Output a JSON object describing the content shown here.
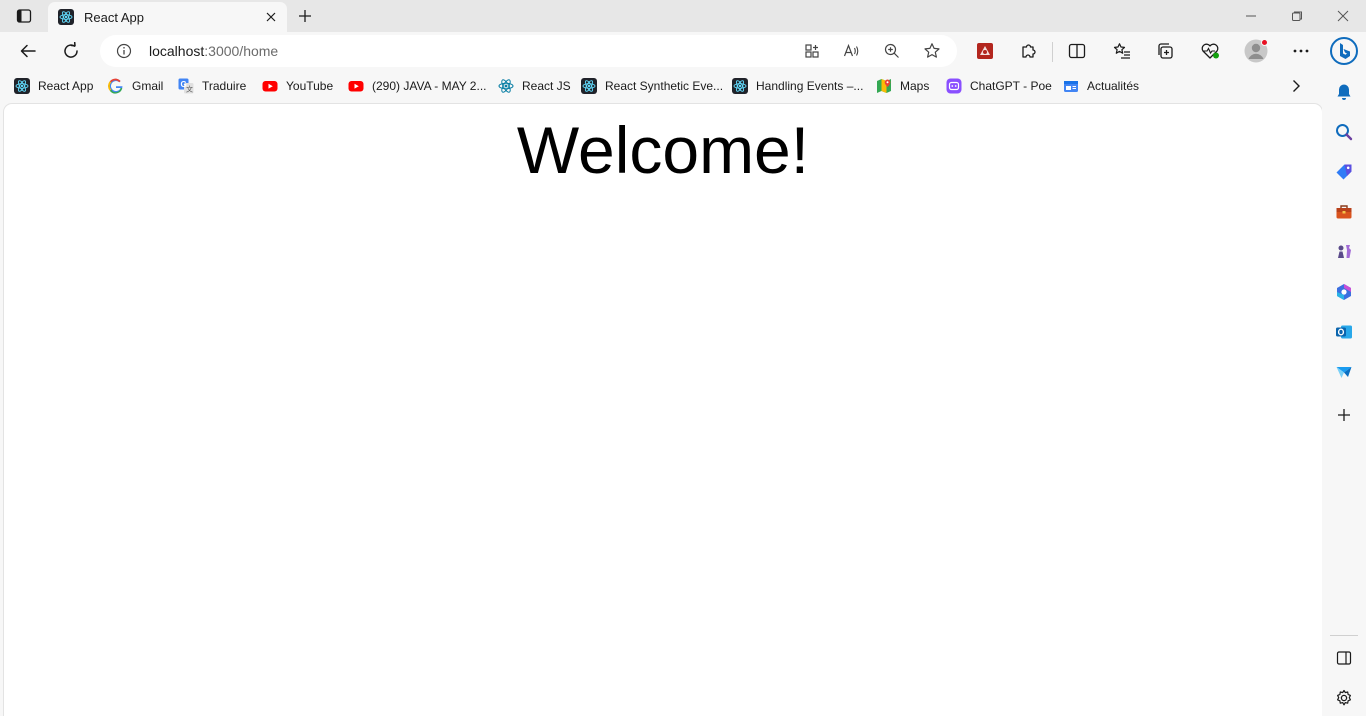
{
  "tab": {
    "title": "React App",
    "favicon": "react-icon"
  },
  "toolbar": {
    "url_host": "localhost",
    "url_path": ":3000/home"
  },
  "favorites": [
    {
      "label": "React App",
      "icon": "react-icon"
    },
    {
      "label": "Gmail",
      "icon": "google-icon"
    },
    {
      "label": "Traduire",
      "icon": "translate-icon"
    },
    {
      "label": "YouTube",
      "icon": "youtube-icon"
    },
    {
      "label": "(290) JAVA - MAY 2...",
      "icon": "youtube-icon"
    },
    {
      "label": "React JS",
      "icon": "react-icon"
    },
    {
      "label": "React Synthetic Eve...",
      "icon": "react-icon"
    },
    {
      "label": "Handling Events –...",
      "icon": "react-icon"
    },
    {
      "label": "Maps",
      "icon": "maps-icon"
    },
    {
      "label": "ChatGPT - Poe",
      "icon": "poe-icon"
    },
    {
      "label": "Actualités",
      "icon": "news-icon"
    }
  ],
  "page": {
    "heading": "Welcome!"
  },
  "colors": {
    "accent_blue": "#0f6cbd",
    "youtube_red": "#ff0000",
    "react_cyan": "#61dafb",
    "react_bg": "#20232a",
    "profile_dot": "#e81123"
  }
}
